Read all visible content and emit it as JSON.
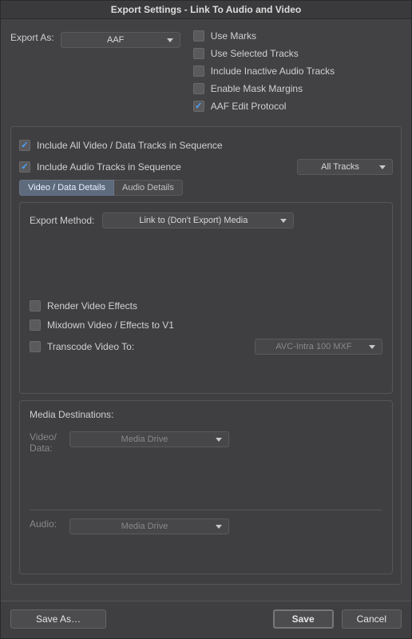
{
  "window": {
    "title": "Export Settings - Link To Audio and Video"
  },
  "exportAs": {
    "label": "Export As:",
    "value": "AAF"
  },
  "topChecks": {
    "useMarks": {
      "label": "Use Marks",
      "checked": false
    },
    "useSelectedTracks": {
      "label": "Use Selected Tracks",
      "checked": false
    },
    "includeInactive": {
      "label": "Include Inactive Audio Tracks",
      "checked": false
    },
    "enableMask": {
      "label": "Enable Mask Margins",
      "checked": false
    },
    "aafEdit": {
      "label": "AAF Edit Protocol",
      "checked": true
    }
  },
  "includePanel": {
    "includeVideo": {
      "label": "Include All Video / Data Tracks in Sequence",
      "checked": true
    },
    "includeAudio": {
      "label": "Include Audio Tracks in Sequence",
      "checked": true
    },
    "allTracksDropdown": "All Tracks",
    "tabs": {
      "video": "Video / Data Details",
      "audio": "Audio Details"
    }
  },
  "exportMethod": {
    "label": "Export Method:",
    "value": "Link to (Don't Export) Media",
    "renderEffects": {
      "label": "Render Video Effects",
      "checked": false
    },
    "mixdown": {
      "label": "Mixdown Video / Effects to V1",
      "checked": false
    },
    "transcode": {
      "label": "Transcode Video To:",
      "checked": false,
      "value": "AVC-Intra 100  MXF"
    }
  },
  "mediaDest": {
    "title": "Media Destinations:",
    "video": {
      "label": "Video/\nData:",
      "value": "Media Drive"
    },
    "audio": {
      "label": "Audio:",
      "value": "Media Drive"
    }
  },
  "footer": {
    "saveAs": "Save As…",
    "save": "Save",
    "cancel": "Cancel"
  }
}
